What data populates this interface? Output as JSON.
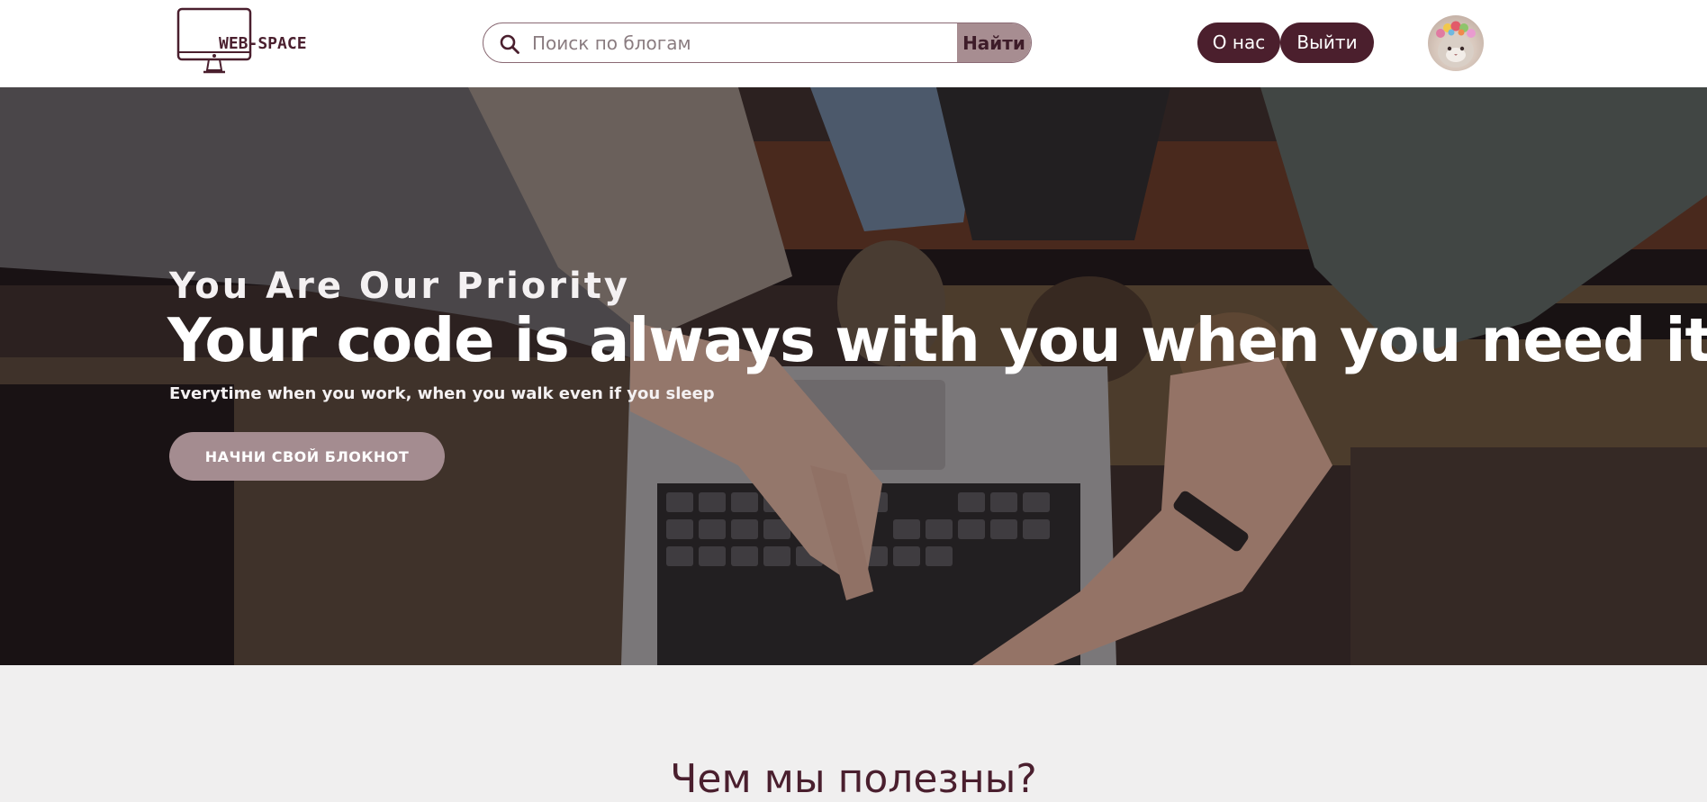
{
  "header": {
    "logo_text": "WEB-SPACE",
    "search": {
      "placeholder": "Поиск по блогам",
      "value": "",
      "button_label": "Найти"
    },
    "nav": {
      "about_label": "О нас",
      "logout_label": "Выйти"
    }
  },
  "hero": {
    "eyebrow": "You Are Our Priority",
    "title": "Your code is always with you when you need it",
    "subtitle": "Everytime when you work, when you walk even if you sleep",
    "cta_label": "НАЧНИ СВОЙ БЛОКНОТ"
  },
  "section": {
    "title": "Чем мы полезны?"
  },
  "icons": {
    "logo": "monitor-icon",
    "search": "search-icon",
    "avatar": "user-avatar"
  },
  "colors": {
    "brand": "#4b1f2d",
    "accent": "#a78d91",
    "section_background": "#f0efef"
  }
}
